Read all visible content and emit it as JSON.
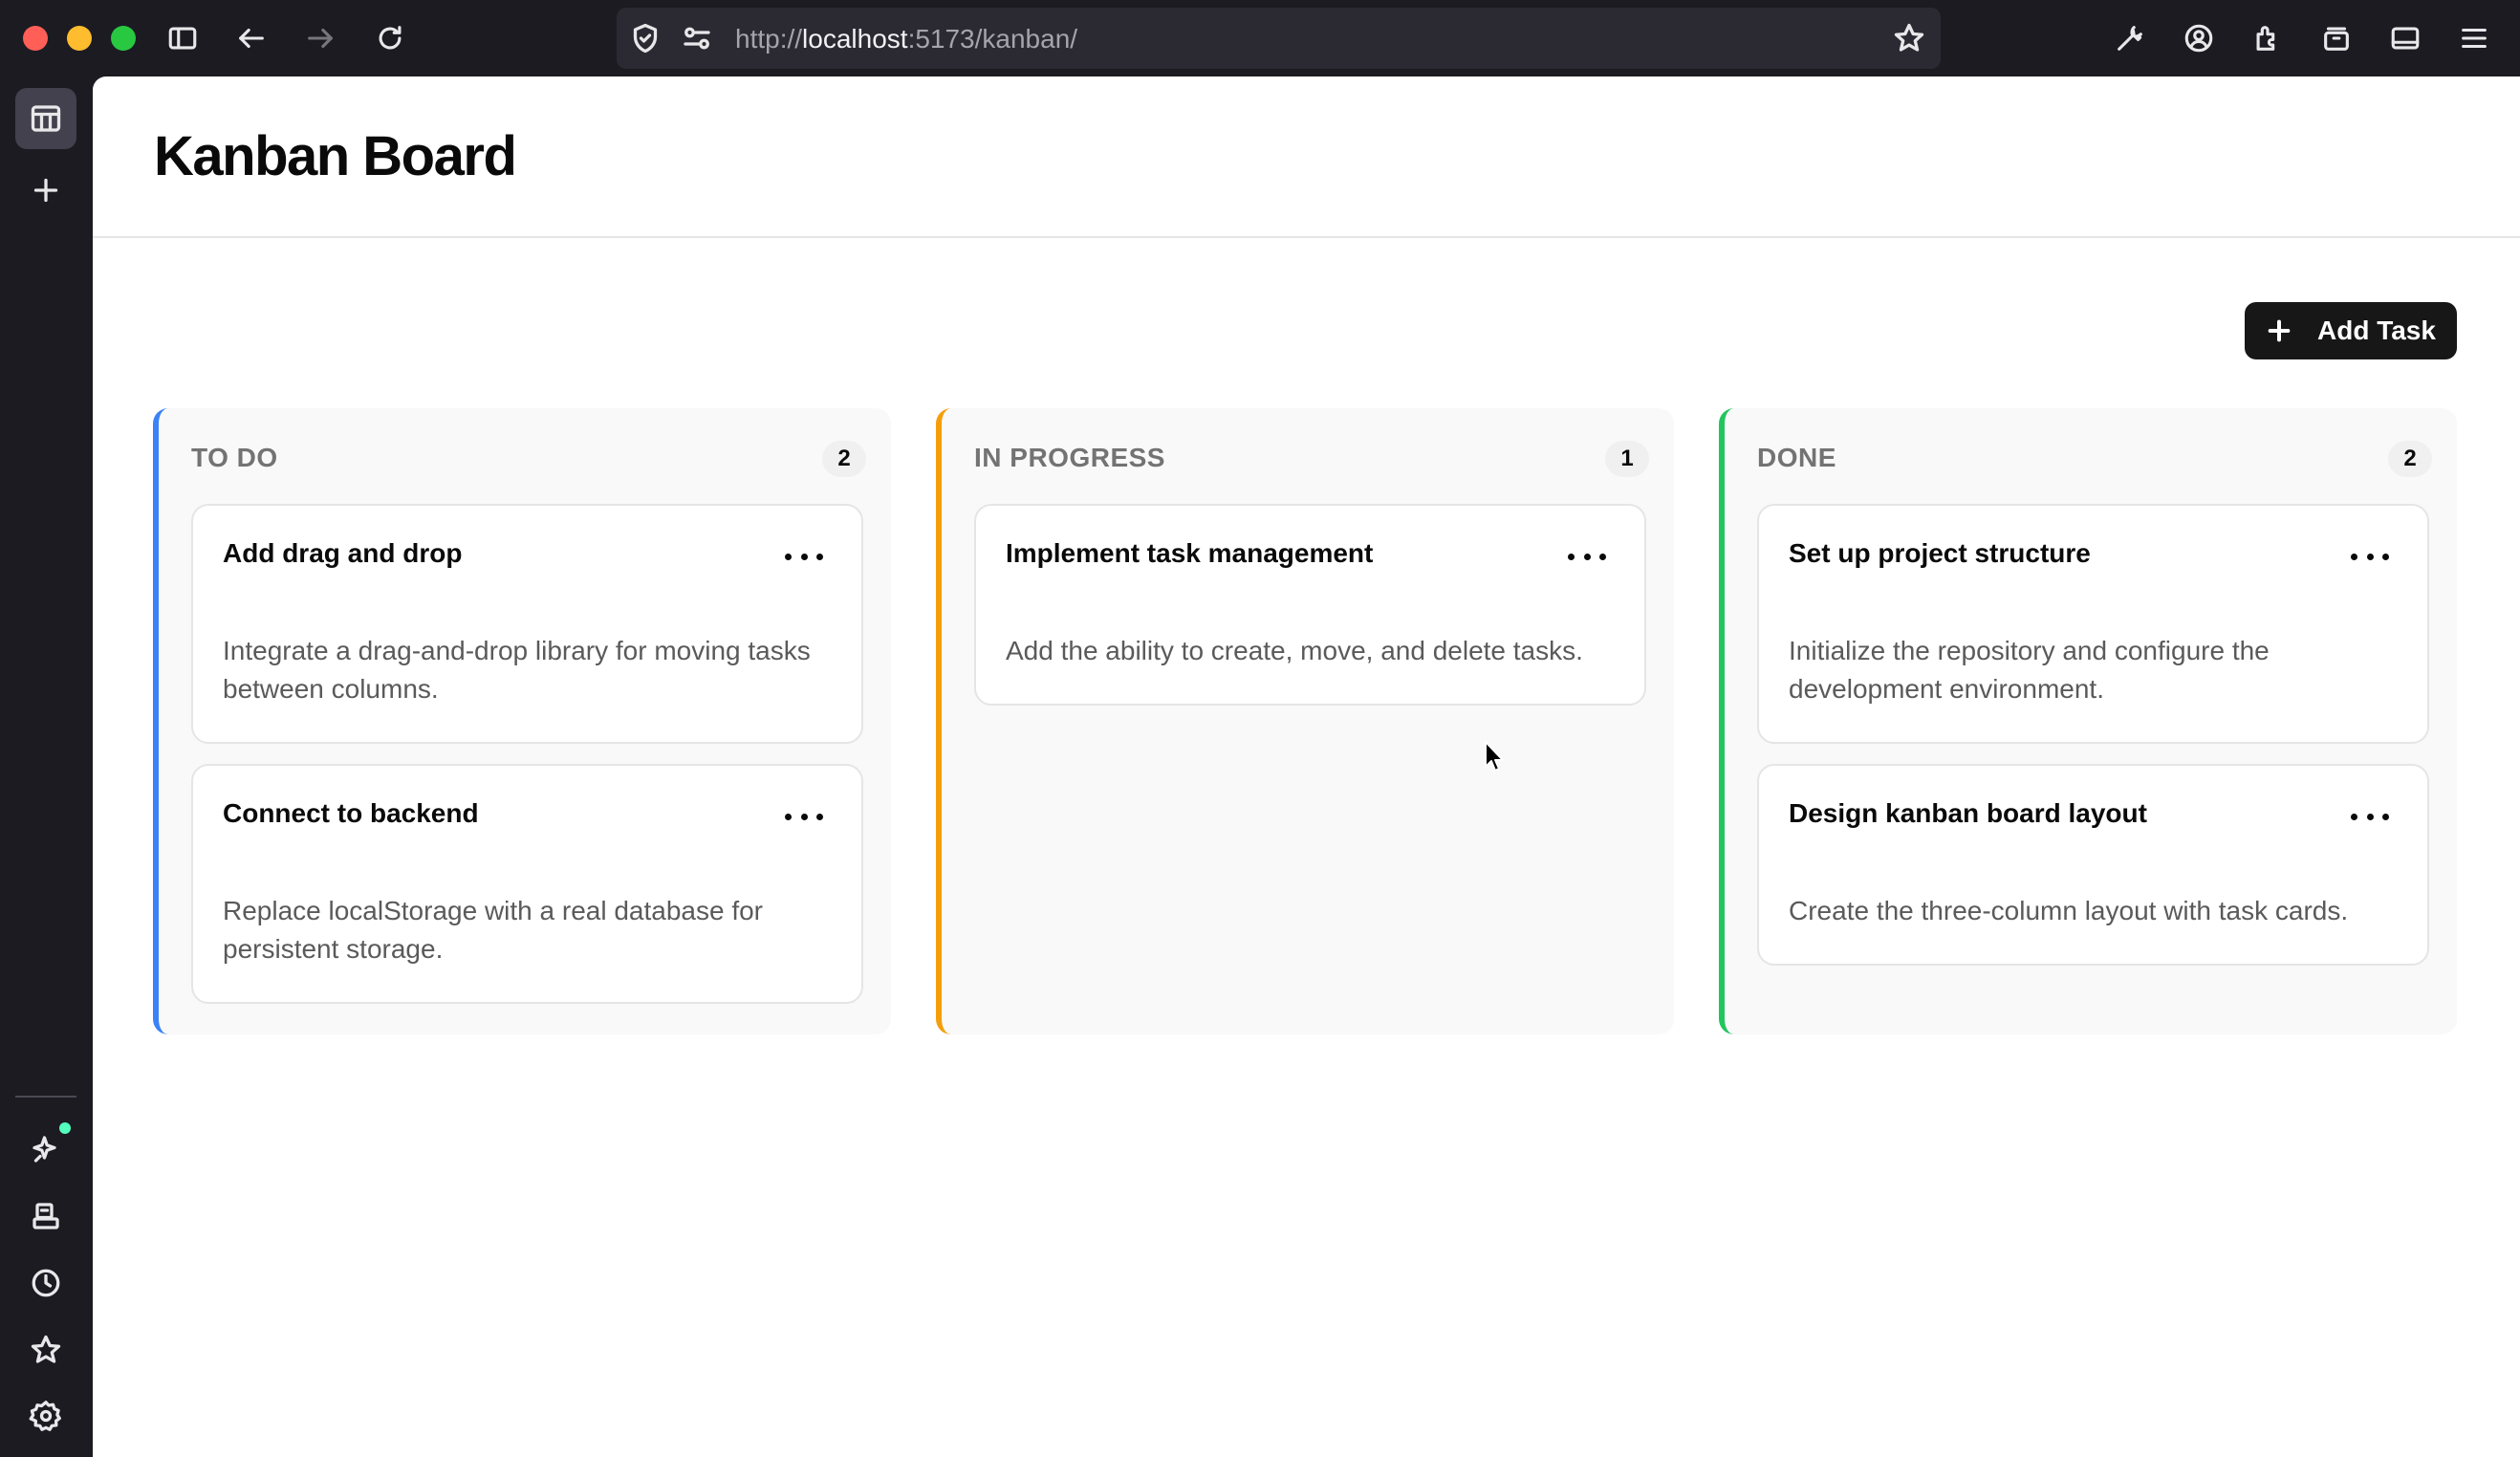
{
  "browser": {
    "url_host": "localhost",
    "url_prefix": "http://",
    "url_suffix": ":5173/kanban/"
  },
  "page": {
    "title": "Kanban Board",
    "add_task_label": "Add Task"
  },
  "columns": [
    {
      "title": "TO DO",
      "count": "2",
      "accent": "#3b82f6",
      "cards": [
        {
          "title": "Add drag and drop",
          "description": "Integrate a drag-and-drop library for moving tasks between columns."
        },
        {
          "title": "Connect to backend",
          "description": "Replace localStorage with a real database for persistent storage."
        }
      ]
    },
    {
      "title": "IN PROGRESS",
      "count": "1",
      "accent": "#f59e0b",
      "cards": [
        {
          "title": "Implement task management",
          "description": "Add the ability to create, move, and delete tasks."
        }
      ]
    },
    {
      "title": "DONE",
      "count": "2",
      "accent": "#22c55e",
      "cards": [
        {
          "title": "Set up project structure",
          "description": "Initialize the repository and configure the development environment."
        },
        {
          "title": "Design kanban board layout",
          "description": "Create the three-column layout with task cards."
        }
      ]
    }
  ],
  "icons": {
    "sidebar_top": [
      "panel-icon",
      "plus-icon"
    ],
    "sidebar_bottom": [
      "sparkle-icon",
      "synced-tabs-icon",
      "history-icon",
      "bookmark-star-icon",
      "settings-icon"
    ],
    "toolbar": [
      "sidebar-toggle-icon",
      "back-icon",
      "forward-icon",
      "reload-icon",
      "shield-icon",
      "permissions-icon",
      "bookmark-star-icon",
      "wrench-icon",
      "account-icon",
      "extensions-icon",
      "container-icon",
      "sidebar-panel-icon",
      "menu-icon"
    ]
  }
}
